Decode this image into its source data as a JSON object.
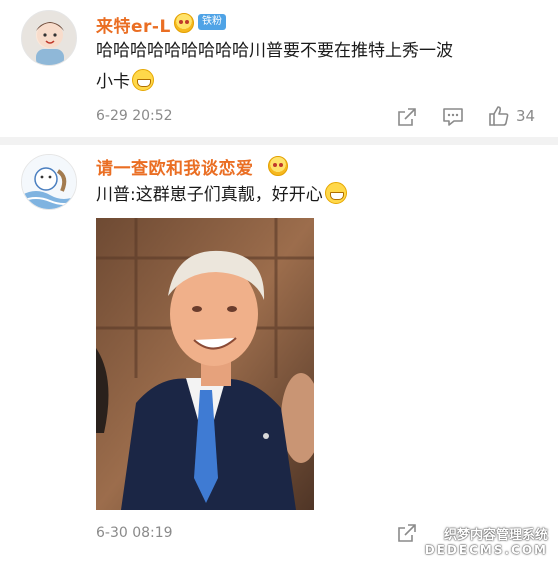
{
  "comments": [
    {
      "username": "来特er-L",
      "badge": "铁粉",
      "text_line1": "哈哈哈哈哈哈哈哈哈川普要不要在推特上秀一波",
      "text_line2": "小卡",
      "time": "6-29 20:52",
      "like_count": "34"
    },
    {
      "username": "请一查欧和我谈恋爱",
      "text": "川普:这群崽子们真靓，好开心",
      "time": "6-30 08:19"
    }
  ],
  "watermark": {
    "line1": "织梦内容管理系统",
    "line2": "DEDECMS.COM"
  },
  "icons": [
    "share-icon",
    "comment-icon",
    "like-icon",
    "crown-emoji-icon",
    "grin-emoji-icon"
  ],
  "colors": {
    "username": "#ea6e23",
    "badge": "#4fa3e6",
    "meta": "#8a8a8a"
  }
}
